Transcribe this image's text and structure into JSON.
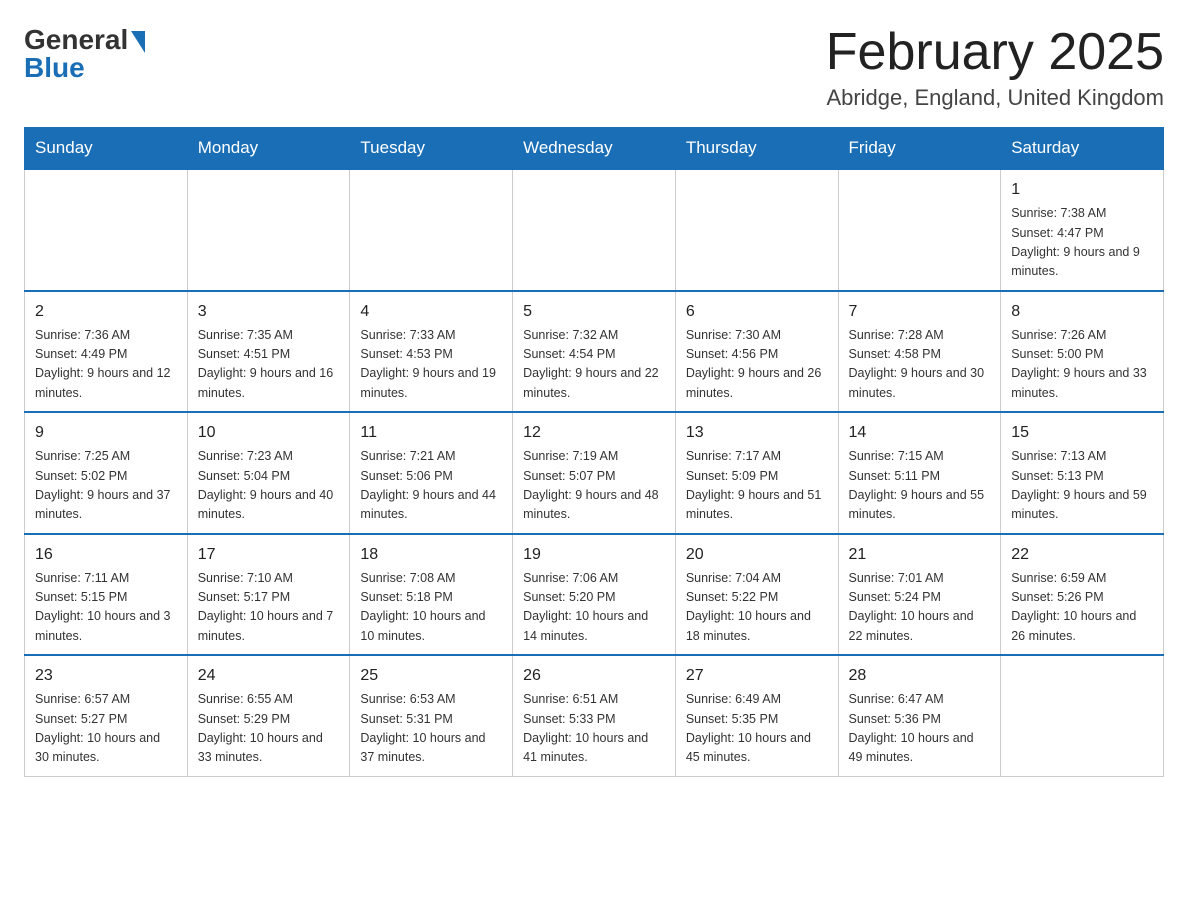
{
  "logo": {
    "general": "General",
    "blue": "Blue"
  },
  "header": {
    "title": "February 2025",
    "location": "Abridge, England, United Kingdom"
  },
  "weekdays": [
    "Sunday",
    "Monday",
    "Tuesday",
    "Wednesday",
    "Thursday",
    "Friday",
    "Saturday"
  ],
  "weeks": [
    [
      {
        "day": "",
        "info": ""
      },
      {
        "day": "",
        "info": ""
      },
      {
        "day": "",
        "info": ""
      },
      {
        "day": "",
        "info": ""
      },
      {
        "day": "",
        "info": ""
      },
      {
        "day": "",
        "info": ""
      },
      {
        "day": "1",
        "info": "Sunrise: 7:38 AM\nSunset: 4:47 PM\nDaylight: 9 hours and 9 minutes."
      }
    ],
    [
      {
        "day": "2",
        "info": "Sunrise: 7:36 AM\nSunset: 4:49 PM\nDaylight: 9 hours and 12 minutes."
      },
      {
        "day": "3",
        "info": "Sunrise: 7:35 AM\nSunset: 4:51 PM\nDaylight: 9 hours and 16 minutes."
      },
      {
        "day": "4",
        "info": "Sunrise: 7:33 AM\nSunset: 4:53 PM\nDaylight: 9 hours and 19 minutes."
      },
      {
        "day": "5",
        "info": "Sunrise: 7:32 AM\nSunset: 4:54 PM\nDaylight: 9 hours and 22 minutes."
      },
      {
        "day": "6",
        "info": "Sunrise: 7:30 AM\nSunset: 4:56 PM\nDaylight: 9 hours and 26 minutes."
      },
      {
        "day": "7",
        "info": "Sunrise: 7:28 AM\nSunset: 4:58 PM\nDaylight: 9 hours and 30 minutes."
      },
      {
        "day": "8",
        "info": "Sunrise: 7:26 AM\nSunset: 5:00 PM\nDaylight: 9 hours and 33 minutes."
      }
    ],
    [
      {
        "day": "9",
        "info": "Sunrise: 7:25 AM\nSunset: 5:02 PM\nDaylight: 9 hours and 37 minutes."
      },
      {
        "day": "10",
        "info": "Sunrise: 7:23 AM\nSunset: 5:04 PM\nDaylight: 9 hours and 40 minutes."
      },
      {
        "day": "11",
        "info": "Sunrise: 7:21 AM\nSunset: 5:06 PM\nDaylight: 9 hours and 44 minutes."
      },
      {
        "day": "12",
        "info": "Sunrise: 7:19 AM\nSunset: 5:07 PM\nDaylight: 9 hours and 48 minutes."
      },
      {
        "day": "13",
        "info": "Sunrise: 7:17 AM\nSunset: 5:09 PM\nDaylight: 9 hours and 51 minutes."
      },
      {
        "day": "14",
        "info": "Sunrise: 7:15 AM\nSunset: 5:11 PM\nDaylight: 9 hours and 55 minutes."
      },
      {
        "day": "15",
        "info": "Sunrise: 7:13 AM\nSunset: 5:13 PM\nDaylight: 9 hours and 59 minutes."
      }
    ],
    [
      {
        "day": "16",
        "info": "Sunrise: 7:11 AM\nSunset: 5:15 PM\nDaylight: 10 hours and 3 minutes."
      },
      {
        "day": "17",
        "info": "Sunrise: 7:10 AM\nSunset: 5:17 PM\nDaylight: 10 hours and 7 minutes."
      },
      {
        "day": "18",
        "info": "Sunrise: 7:08 AM\nSunset: 5:18 PM\nDaylight: 10 hours and 10 minutes."
      },
      {
        "day": "19",
        "info": "Sunrise: 7:06 AM\nSunset: 5:20 PM\nDaylight: 10 hours and 14 minutes."
      },
      {
        "day": "20",
        "info": "Sunrise: 7:04 AM\nSunset: 5:22 PM\nDaylight: 10 hours and 18 minutes."
      },
      {
        "day": "21",
        "info": "Sunrise: 7:01 AM\nSunset: 5:24 PM\nDaylight: 10 hours and 22 minutes."
      },
      {
        "day": "22",
        "info": "Sunrise: 6:59 AM\nSunset: 5:26 PM\nDaylight: 10 hours and 26 minutes."
      }
    ],
    [
      {
        "day": "23",
        "info": "Sunrise: 6:57 AM\nSunset: 5:27 PM\nDaylight: 10 hours and 30 minutes."
      },
      {
        "day": "24",
        "info": "Sunrise: 6:55 AM\nSunset: 5:29 PM\nDaylight: 10 hours and 33 minutes."
      },
      {
        "day": "25",
        "info": "Sunrise: 6:53 AM\nSunset: 5:31 PM\nDaylight: 10 hours and 37 minutes."
      },
      {
        "day": "26",
        "info": "Sunrise: 6:51 AM\nSunset: 5:33 PM\nDaylight: 10 hours and 41 minutes."
      },
      {
        "day": "27",
        "info": "Sunrise: 6:49 AM\nSunset: 5:35 PM\nDaylight: 10 hours and 45 minutes."
      },
      {
        "day": "28",
        "info": "Sunrise: 6:47 AM\nSunset: 5:36 PM\nDaylight: 10 hours and 49 minutes."
      },
      {
        "day": "",
        "info": ""
      }
    ]
  ]
}
